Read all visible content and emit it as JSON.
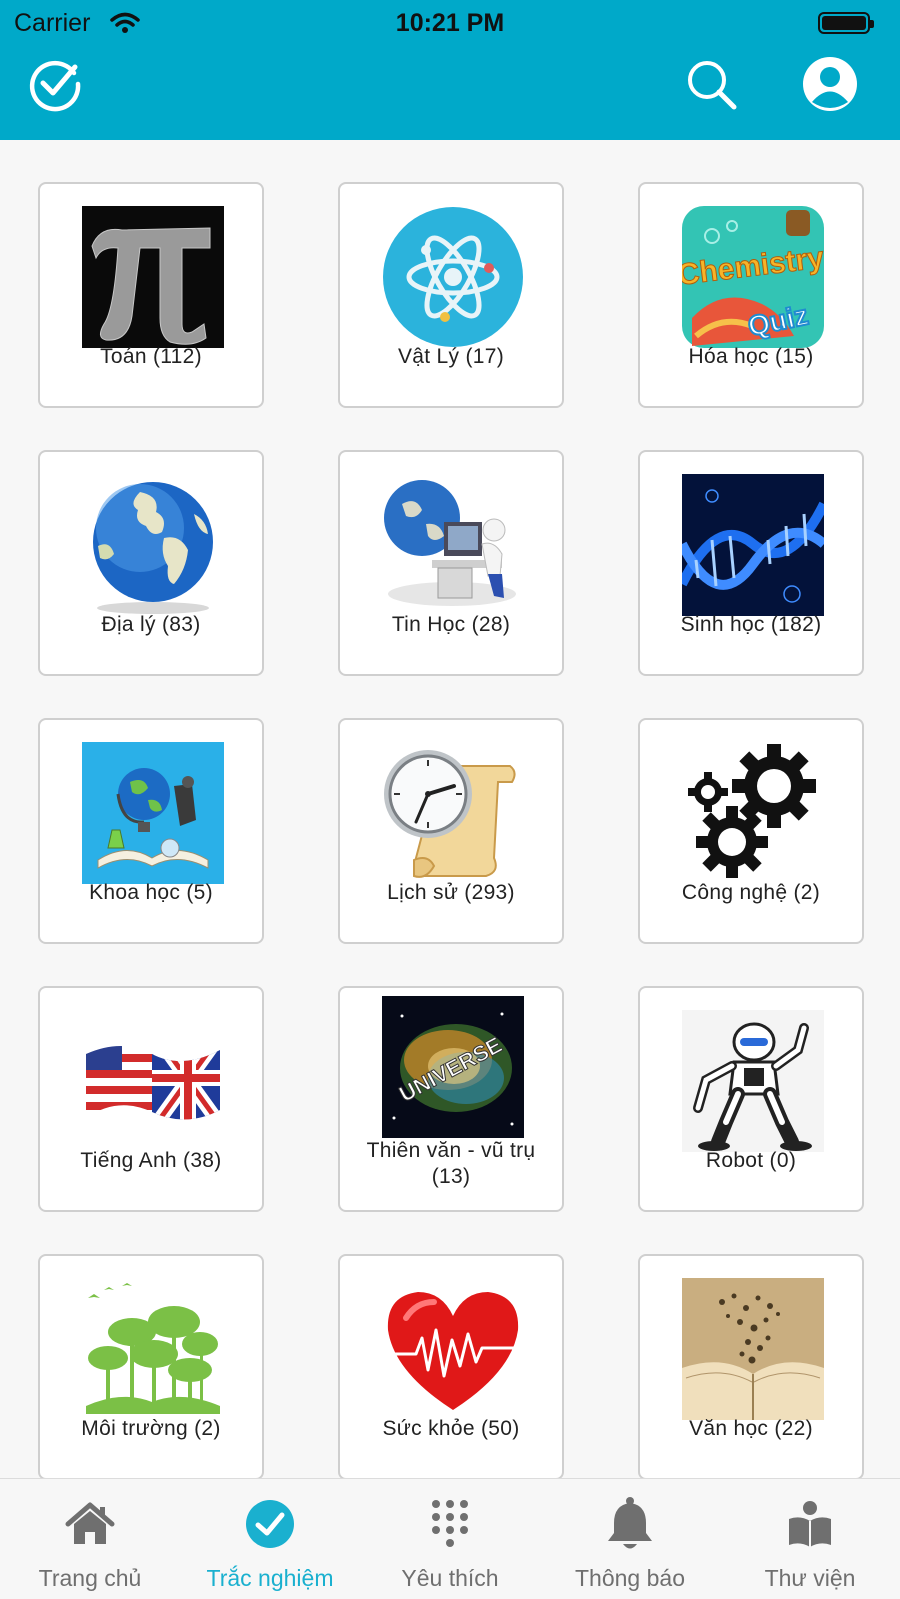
{
  "status_bar": {
    "carrier": "Carrier",
    "time": "10:21 PM"
  },
  "header": {
    "left_icon": "check-circle-icon",
    "search_icon": "search-icon",
    "profile_icon": "user-icon",
    "color": "#00a9c9"
  },
  "subjects": [
    {
      "label": "Toán (112)",
      "icon": "pi-icon"
    },
    {
      "label": "Vật Lý (17)",
      "icon": "atom-icon"
    },
    {
      "label": "Hóa học (15)",
      "icon": "chemistry-quiz-icon",
      "image_text_1": "Chemistry",
      "image_text_2": "Quiz"
    },
    {
      "label": "Địa lý (83)",
      "icon": "globe-icon"
    },
    {
      "label": "Tin Học (28)",
      "icon": "computer-icon"
    },
    {
      "label": "Sinh học (182)",
      "icon": "dna-icon"
    },
    {
      "label": "Khoa học (5)",
      "icon": "science-icon"
    },
    {
      "label": "Lịch sử (293)",
      "icon": "clock-scroll-icon"
    },
    {
      "label": "Công nghệ (2)",
      "icon": "gears-icon"
    },
    {
      "label": "Tiếng Anh (38)",
      "icon": "flag-icon"
    },
    {
      "label": "Thiên văn - vũ trụ (13)",
      "icon": "universe-icon",
      "image_text": "UNIVERSE"
    },
    {
      "label": "Robot (0)",
      "icon": "robot-icon"
    },
    {
      "label": "Môi trường (2)",
      "icon": "forest-icon"
    },
    {
      "label": "Sức khỏe (50)",
      "icon": "heart-icon"
    },
    {
      "label": "Văn học (22)",
      "icon": "book-icon"
    }
  ],
  "tabs": [
    {
      "label": "Trang chủ",
      "icon": "home-icon",
      "active": false
    },
    {
      "label": "Trắc nghiệm",
      "icon": "check-circle-icon",
      "active": true
    },
    {
      "label": "Yêu thích",
      "icon": "keypad-icon",
      "active": false
    },
    {
      "label": "Thông báo",
      "icon": "bell-icon",
      "active": false
    },
    {
      "label": "Thư viện",
      "icon": "library-icon",
      "active": false
    }
  ],
  "colors": {
    "accent": "#00a9c9",
    "active_tab": "#1ab0cf",
    "inactive_tab": "#6f6f6f"
  }
}
